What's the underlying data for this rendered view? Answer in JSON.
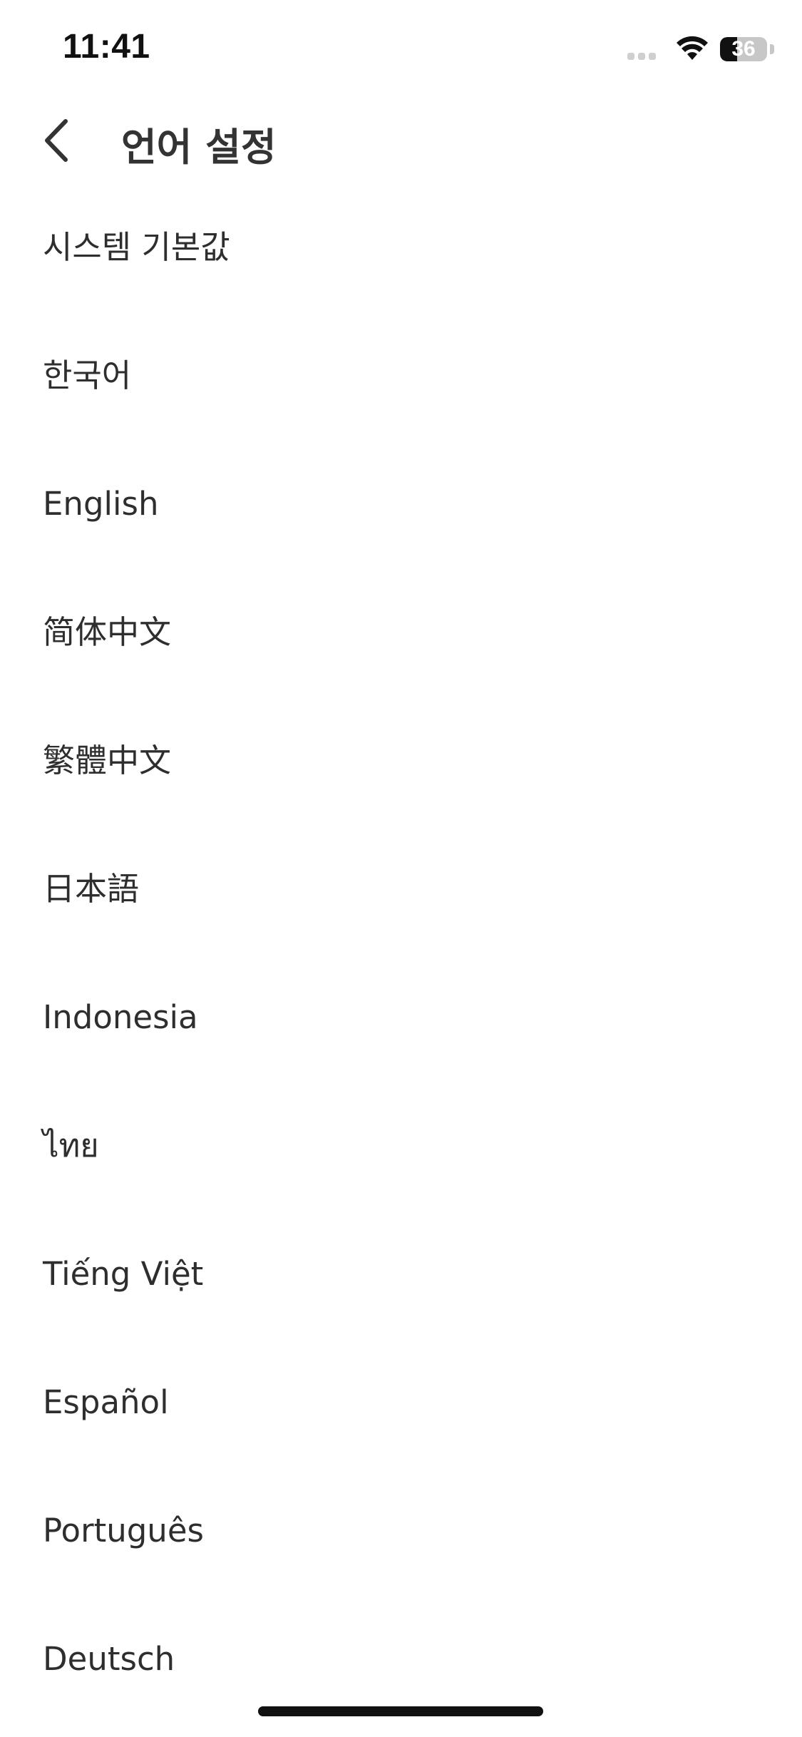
{
  "status_bar": {
    "time": "11:41",
    "battery_text": "36",
    "battery_level_percent": 36,
    "icons": [
      "cellular-signal-icon",
      "wifi-icon",
      "battery-icon"
    ]
  },
  "header": {
    "back_icon": "chevron-left-icon",
    "title": "언어 설정"
  },
  "languages": [
    {
      "label": "시스템 기본값"
    },
    {
      "label": "한국어"
    },
    {
      "label": "English"
    },
    {
      "label": "简体中文"
    },
    {
      "label": "繁體中文"
    },
    {
      "label": "日本語"
    },
    {
      "label": "Indonesia"
    },
    {
      "label": "ไทย"
    },
    {
      "label": "Tiếng Việt"
    },
    {
      "label": "Español"
    },
    {
      "label": "Português"
    },
    {
      "label": "Deutsch"
    }
  ],
  "colors": {
    "background": "#ffffff",
    "text": "#2e2e2e",
    "title": "#333333",
    "home_indicator": "#111111"
  }
}
